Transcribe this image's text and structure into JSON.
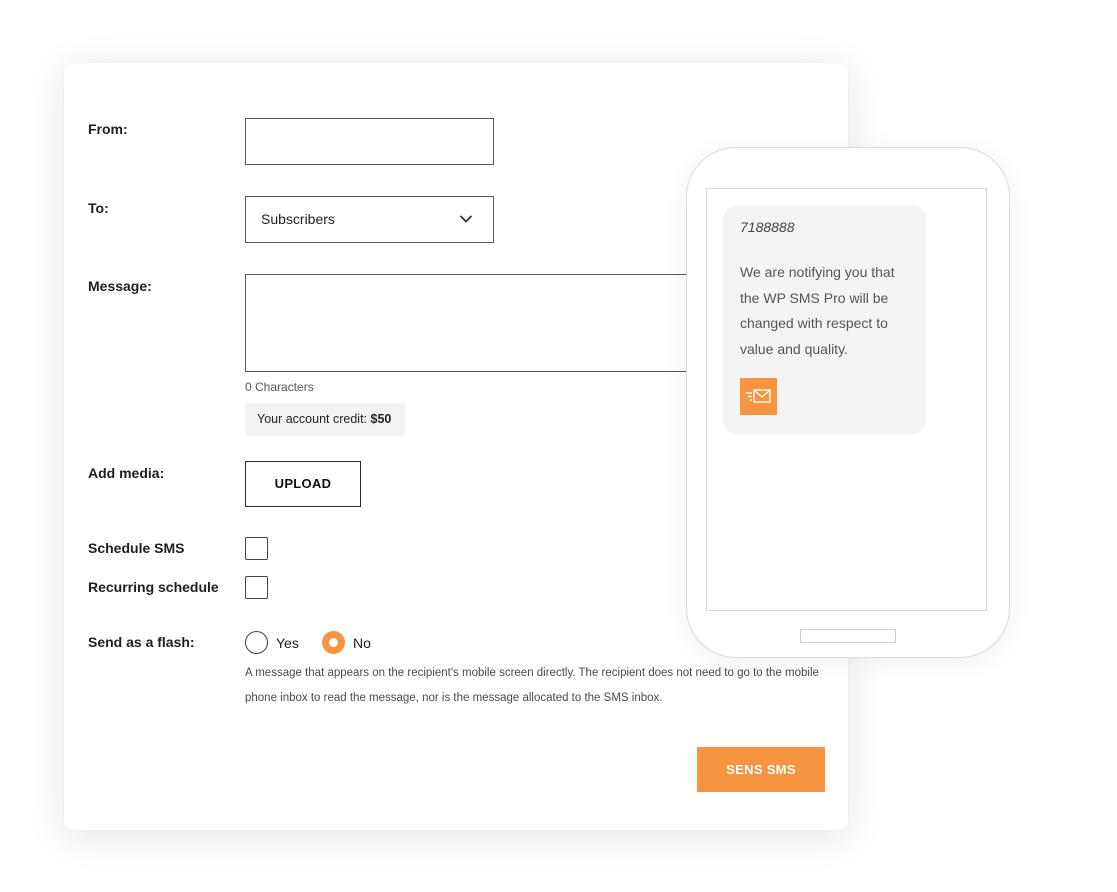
{
  "form": {
    "from_label": "From:",
    "from_value": "",
    "to_label": "To:",
    "to_selected": "Subscribers",
    "message_label": "Message:",
    "message_value": "",
    "char_count": "0 Characters",
    "credit_label": "Your account credit:",
    "credit_value": "$50",
    "media_label": "Add media:",
    "upload_label": "UPLOAD",
    "schedule_label": "Schedule SMS",
    "recurring_label": "Recurring schedule",
    "flash_label": "Send as a flash:",
    "flash_yes": "Yes",
    "flash_no": "No",
    "flash_selected": "No",
    "flash_description": "A message that appears on the recipient's mobile screen directly. The recipient does not need to go to the mobile phone inbox to read the message, nor is the message allocated to the SMS inbox.",
    "send_label": "SENS SMS"
  },
  "phone": {
    "sender": "7188888",
    "message": "We are notifying you that the WP SMS Pro will be changed with respect to value and quality.",
    "icon": "mail-icon"
  },
  "colors": {
    "accent": "#f7943f",
    "text": "#1f1f1f",
    "muted": "#555555"
  }
}
